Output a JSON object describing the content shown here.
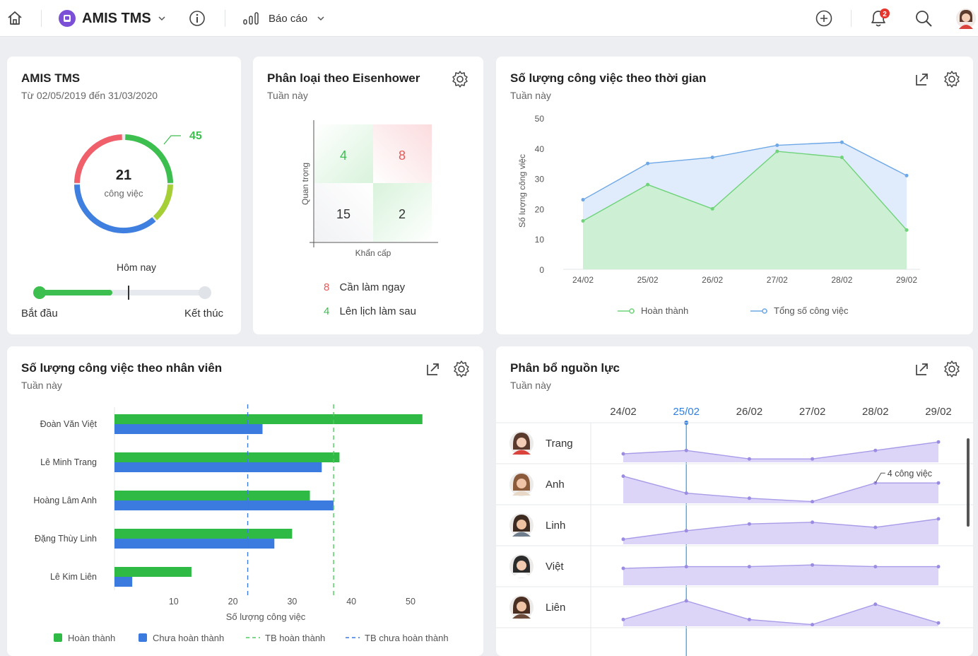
{
  "topbar": {
    "app_name": "AMIS TMS",
    "report_label": "Báo cáo",
    "notification_count": "2"
  },
  "card_tms": {
    "title": "AMIS TMS",
    "date_range": "Từ 02/05/2019 đến 31/03/2020",
    "total": "21",
    "total_unit": "công việc",
    "peak_label": "45",
    "today_label": "Hôm nay",
    "start_label": "Bắt đầu",
    "end_label": "Kết thúc",
    "progress_fraction": 0.44,
    "today_fraction": 0.6
  },
  "card_eisenhower": {
    "title": "Phân loại theo Eisenhower",
    "subtitle": "Tuần này",
    "y_axis_label": "Quan trọng",
    "x_axis_label": "Khẩn cấp",
    "cells": [
      "4",
      "8",
      "15",
      "2"
    ],
    "legend": [
      {
        "count": "8",
        "label": "Cần làm ngay",
        "color": "#e55b5b"
      },
      {
        "count": "4",
        "label": "Lên lịch làm sau",
        "color": "#3cbf4e"
      }
    ]
  },
  "card_time": {
    "title": "Số lượng công việc theo thời gian",
    "subtitle": "Tuần này",
    "chart_data": {
      "type": "area",
      "categories": [
        "24/02",
        "25/02",
        "26/02",
        "27/02",
        "28/02",
        "29/02"
      ],
      "series": [
        {
          "name": "Hoàn thành",
          "values": [
            16,
            28,
            20,
            39,
            37,
            13
          ],
          "color": "#6fd37a"
        },
        {
          "name": "Tổng số công việc",
          "values": [
            23,
            35,
            37,
            41,
            42,
            31
          ],
          "color": "#6ea8e6"
        }
      ],
      "ylabel": "Số lượng công việc",
      "yticks": [
        "0",
        "10",
        "20",
        "30",
        "40",
        "50"
      ],
      "ylim": [
        0,
        50
      ]
    }
  },
  "card_staff": {
    "title": "Số lượng công việc theo nhân viên",
    "subtitle": "Tuần này",
    "chart_data": {
      "type": "bar",
      "categories": [
        "Đoàn Văn Việt",
        "Lê Minh Trang",
        "Hoàng Lâm Anh",
        "Đặng Thùy Linh",
        "Lê Kim Liên"
      ],
      "series": [
        {
          "name": "Hoàn thành",
          "values": [
            52,
            38,
            33,
            30,
            13
          ],
          "color": "#2fba45"
        },
        {
          "name": "Chưa hoàn thành",
          "values": [
            25,
            35,
            37,
            27,
            3
          ],
          "color": "#3b7be0"
        }
      ],
      "reference_lines": [
        {
          "name": "TB hoàn thành",
          "value": 37,
          "color": "#4ecb5e"
        },
        {
          "name": "TB chưa hoàn thành",
          "value": 22.5,
          "color": "#3b7be0"
        }
      ],
      "xlabel": "Số lượng công việc",
      "xticks": [
        "10",
        "20",
        "30",
        "40",
        "50"
      ],
      "xlim": [
        0,
        60
      ]
    }
  },
  "card_resource": {
    "title": "Phân bổ nguồn lực",
    "subtitle": "Tuần này",
    "dates": [
      "24/02",
      "25/02",
      "26/02",
      "27/02",
      "28/02",
      "29/02"
    ],
    "highlight_date": "25/02",
    "tooltip": "4 công việc",
    "people": [
      {
        "name": "Trang",
        "values": [
          0.25,
          0.35,
          0.1,
          0.1,
          0.35,
          0.6
        ]
      },
      {
        "name": "Anh",
        "values": [
          0.8,
          0.3,
          0.15,
          0.05,
          0.6,
          0.6
        ]
      },
      {
        "name": "Linh",
        "values": [
          0.15,
          0.4,
          0.6,
          0.65,
          0.5,
          0.75
        ]
      },
      {
        "name": "Việt",
        "values": [
          0.5,
          0.55,
          0.55,
          0.6,
          0.55,
          0.55
        ]
      },
      {
        "name": "Liên",
        "values": [
          0.2,
          0.75,
          0.2,
          0.05,
          0.65,
          0.1
        ]
      }
    ]
  }
}
